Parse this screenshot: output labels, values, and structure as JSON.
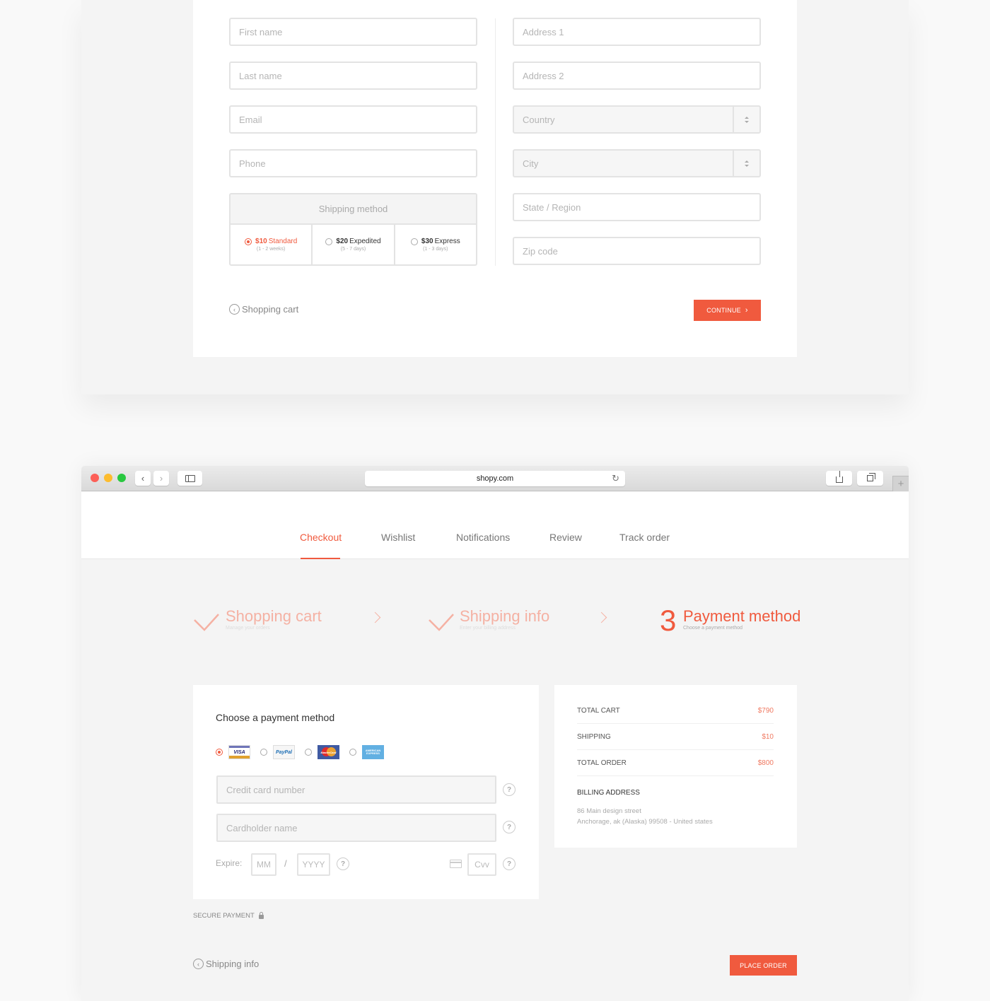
{
  "shipping_form": {
    "left_fields": [
      {
        "placeholder": "First name"
      },
      {
        "placeholder": "Last name"
      },
      {
        "placeholder": "Email"
      },
      {
        "placeholder": "Phone"
      }
    ],
    "right_fields": [
      {
        "placeholder": "Address 1"
      },
      {
        "placeholder": "Address 2"
      },
      {
        "placeholder": "Country",
        "type": "select"
      },
      {
        "placeholder": "City",
        "type": "select"
      },
      {
        "placeholder": "State / Region"
      },
      {
        "placeholder": "Zip code"
      }
    ],
    "shipping_method": {
      "title": "Shipping method",
      "options": [
        {
          "price": "$10",
          "name": "Standard",
          "duration": "(1 - 2 weeks)",
          "selected": true
        },
        {
          "price": "$20",
          "name": "Expedited",
          "duration": "(5 - 7 days)",
          "selected": false
        },
        {
          "price": "$30",
          "name": "Express",
          "duration": "(1 - 3 days)",
          "selected": false
        }
      ]
    },
    "back_link": "Shopping cart",
    "continue_label": "CONTINUE",
    "continue_icon": "chevron-right-icon"
  },
  "browser": {
    "url": "shopy.com",
    "icons": [
      "close-dot",
      "minimize-dot",
      "maximize-dot",
      "back-icon",
      "forward-icon",
      "sidebar-icon",
      "reload-icon",
      "share-icon",
      "tabs-icon",
      "new-tab-icon"
    ],
    "new_tab_label": "+"
  },
  "nav": {
    "items": [
      {
        "label": "Checkout",
        "active": true
      },
      {
        "label": "Wishlist"
      },
      {
        "label": "Notifications"
      },
      {
        "label": "Review"
      },
      {
        "label": "Track order"
      }
    ]
  },
  "steps": [
    {
      "title": "Shopping cart",
      "subtitle": "Manage your orders",
      "status": "done"
    },
    {
      "title": "Shipping info",
      "subtitle": "Enter your billing address",
      "status": "done"
    },
    {
      "number": "3",
      "title": "Payment method",
      "subtitle": "Choose a payment method",
      "status": "current"
    }
  ],
  "payment": {
    "title": "Choose a payment method",
    "methods": [
      {
        "name": "VISA",
        "selected": true
      },
      {
        "name": "PayPal",
        "selected": false
      },
      {
        "name": "MasterCard",
        "selected": false
      },
      {
        "name": "AMERICAN EXPRESS",
        "selected": false
      }
    ],
    "card_number_placeholder": "Credit card number",
    "cardholder_placeholder": "Cardholder name",
    "expire_label": "Expire:",
    "month_placeholder": "MM",
    "year_placeholder": "YYYY",
    "separator": "/",
    "cvv_placeholder": "Cvv",
    "help_glyph": "?"
  },
  "summary": {
    "rows": [
      {
        "label": "TOTAL CART",
        "value": "$790"
      },
      {
        "label": "SHIPPING",
        "value": "$10"
      },
      {
        "label": "TOTAL ORDER",
        "value": "$800"
      }
    ],
    "billing_title": "BILLING ADDRESS",
    "billing_lines": [
      "86 Main design street",
      "Anchorage, ak (Alaska) 99508 - United states"
    ]
  },
  "secure_label": "SECURE PAYMENT",
  "bottom_back_link": "Shipping info",
  "place_order_label": "PLACE ORDER",
  "colors": {
    "accent": "#f05a3e",
    "accent_light": "#f5b1a3"
  }
}
